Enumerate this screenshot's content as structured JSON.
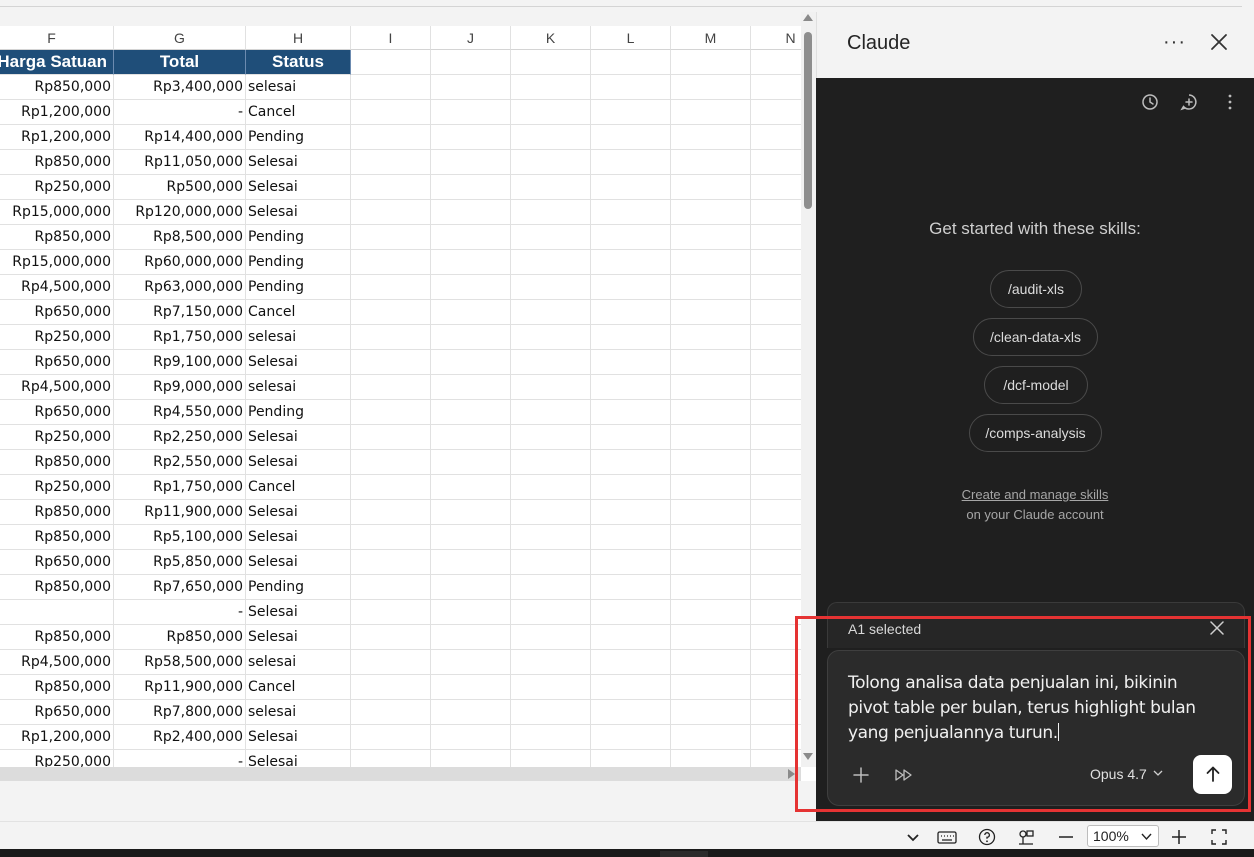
{
  "sheet": {
    "columns": [
      "F",
      "G",
      "H",
      "I",
      "J",
      "K",
      "L",
      "M",
      "N"
    ],
    "header_row": [
      "Harga Satuan",
      "Total",
      "Status"
    ],
    "rows": [
      [
        "Rp850,000",
        "Rp3,400,000",
        "selesai"
      ],
      [
        "Rp1,200,000",
        "-",
        "Cancel"
      ],
      [
        "Rp1,200,000",
        "Rp14,400,000",
        "Pending"
      ],
      [
        "Rp850,000",
        "Rp11,050,000",
        "Selesai"
      ],
      [
        "Rp250,000",
        "Rp500,000",
        "Selesai"
      ],
      [
        "Rp15,000,000",
        "Rp120,000,000",
        "Selesai"
      ],
      [
        "Rp850,000",
        "Rp8,500,000",
        "Pending"
      ],
      [
        "Rp15,000,000",
        "Rp60,000,000",
        "Pending"
      ],
      [
        "Rp4,500,000",
        "Rp63,000,000",
        "Pending"
      ],
      [
        "Rp650,000",
        "Rp7,150,000",
        "Cancel"
      ],
      [
        "Rp250,000",
        "Rp1,750,000",
        "selesai"
      ],
      [
        "Rp650,000",
        "Rp9,100,000",
        "Selesai"
      ],
      [
        "Rp4,500,000",
        "Rp9,000,000",
        "selesai"
      ],
      [
        "Rp650,000",
        "Rp4,550,000",
        "Pending"
      ],
      [
        "Rp250,000",
        "Rp2,250,000",
        "Selesai"
      ],
      [
        "Rp850,000",
        "Rp2,550,000",
        "Selesai"
      ],
      [
        "Rp250,000",
        "Rp1,750,000",
        "Cancel"
      ],
      [
        "Rp850,000",
        "Rp11,900,000",
        "Selesai"
      ],
      [
        "Rp850,000",
        "Rp5,100,000",
        "Selesai"
      ],
      [
        "Rp650,000",
        "Rp5,850,000",
        "Selesai"
      ],
      [
        "Rp850,000",
        "Rp7,650,000",
        "Pending"
      ],
      [
        "",
        "-",
        "Selesai"
      ],
      [
        "Rp850,000",
        "Rp850,000",
        "Selesai"
      ],
      [
        "Rp4,500,000",
        "Rp58,500,000",
        "selesai"
      ],
      [
        "Rp850,000",
        "Rp11,900,000",
        "Cancel"
      ],
      [
        "Rp650,000",
        "Rp7,800,000",
        "selesai"
      ],
      [
        "Rp1,200,000",
        "Rp2,400,000",
        "Selesai"
      ],
      [
        "Rp250,000",
        "-",
        "Selesai"
      ]
    ]
  },
  "panel": {
    "title": "Claude",
    "more_label": "···",
    "skills_title": "Get started with these skills:",
    "skills": [
      "/audit-xls",
      "/clean-data-xls",
      "/dcf-model",
      "/comps-analysis"
    ],
    "manage_link": "Create and manage skills",
    "manage_sub": "on your Claude account",
    "selection_label": "A1 selected",
    "composer_text": "Tolong analisa data penjualan ini, bikinin pivot table per bulan, terus highlight bulan yang penjualannya turun.",
    "model": "Opus 4.7"
  },
  "status_bar": {
    "zoom": "100%"
  },
  "colors": {
    "header_fill": "#1f4e79",
    "panel_bg": "#1f1f1f",
    "highlight": "#e53333"
  }
}
